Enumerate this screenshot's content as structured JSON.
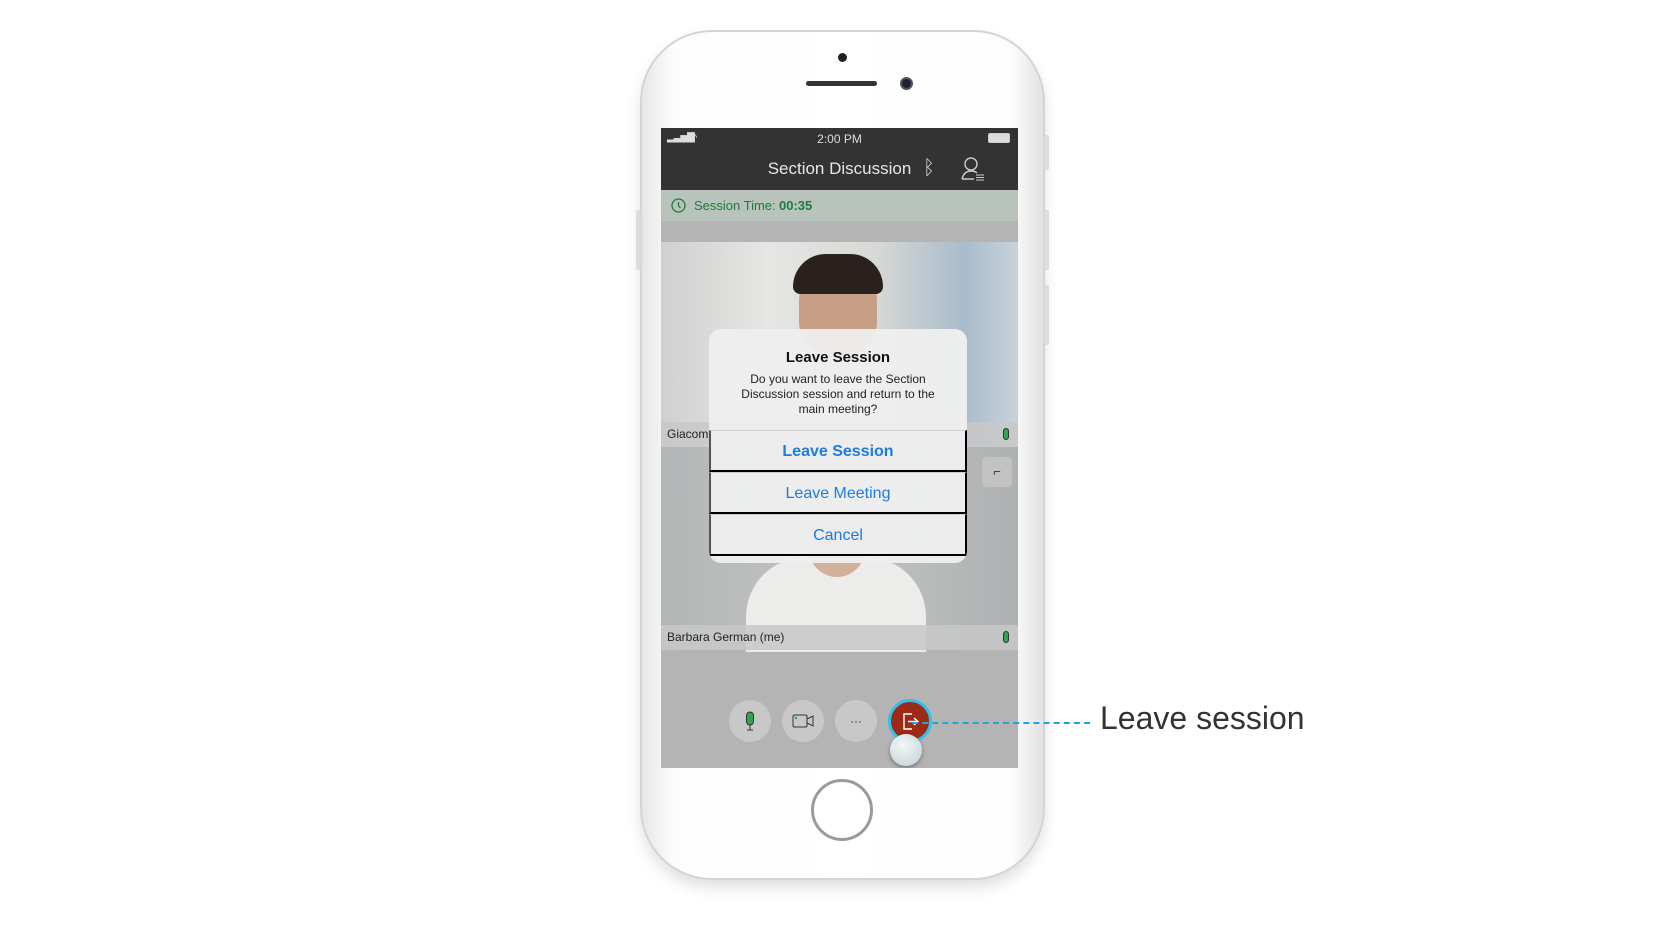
{
  "status_bar": {
    "time": "2:00 PM"
  },
  "header": {
    "title": "Section Discussion",
    "icons": [
      "bluetooth-icon",
      "participants-icon"
    ]
  },
  "session": {
    "label": "Session Time:",
    "time": "00:35"
  },
  "participants": [
    {
      "name": "Giacom"
    },
    {
      "name": "Barbara German (me)"
    }
  ],
  "dialog": {
    "title": "Leave Session",
    "message": "Do you want to leave the Section Discussion session and return to the main meeting?",
    "buttons": [
      "Leave Session",
      "Leave Meeting",
      "Cancel"
    ]
  },
  "controls": {
    "more_label": "···",
    "icons": [
      "microphone-icon",
      "camera-icon",
      "more-icon",
      "leave-session-icon"
    ]
  },
  "callout": {
    "label": "Leave session"
  },
  "colors": {
    "accent": "#1a7de0",
    "leave": "#9c2a17",
    "session_text": "#1e7b3c",
    "callout_line": "#1ea5dc"
  }
}
